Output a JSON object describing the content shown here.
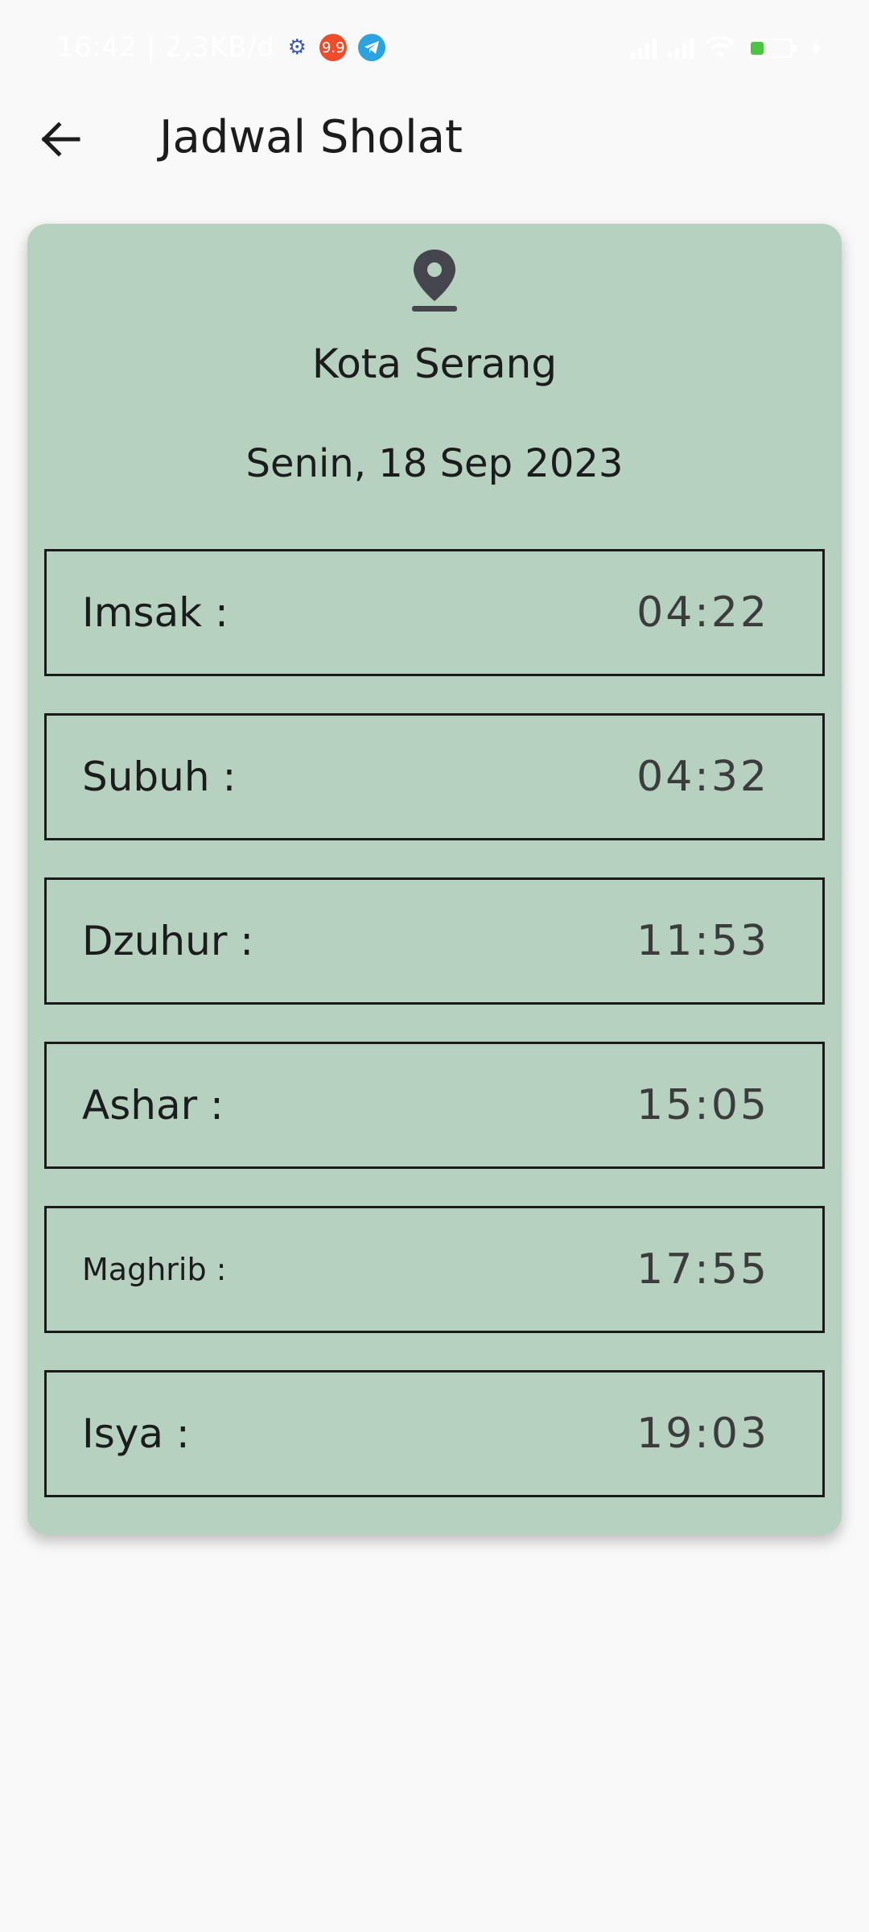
{
  "status_bar": {
    "time_and_speed": "16:42 | 2,3KB/d",
    "shop_badge": "9.9",
    "battery_level": "30"
  },
  "app_bar": {
    "title": "Jadwal Sholat",
    "back_icon": "arrow-left-icon"
  },
  "card": {
    "location_icon": "map-pin-icon",
    "city": "Kota Serang",
    "date": "Senin, 18 Sep 2023",
    "background_color": "#b7d1c1"
  },
  "prayers": [
    {
      "name": "Imsak :",
      "time": "04:22"
    },
    {
      "name": "Subuh :",
      "time": "04:32"
    },
    {
      "name": "Dzuhur :",
      "time": "11:53"
    },
    {
      "name": "Ashar :",
      "time": "15:05"
    },
    {
      "name": "Maghrib :",
      "time": "17:55"
    },
    {
      "name": "Isya :",
      "time": "19:03"
    }
  ]
}
